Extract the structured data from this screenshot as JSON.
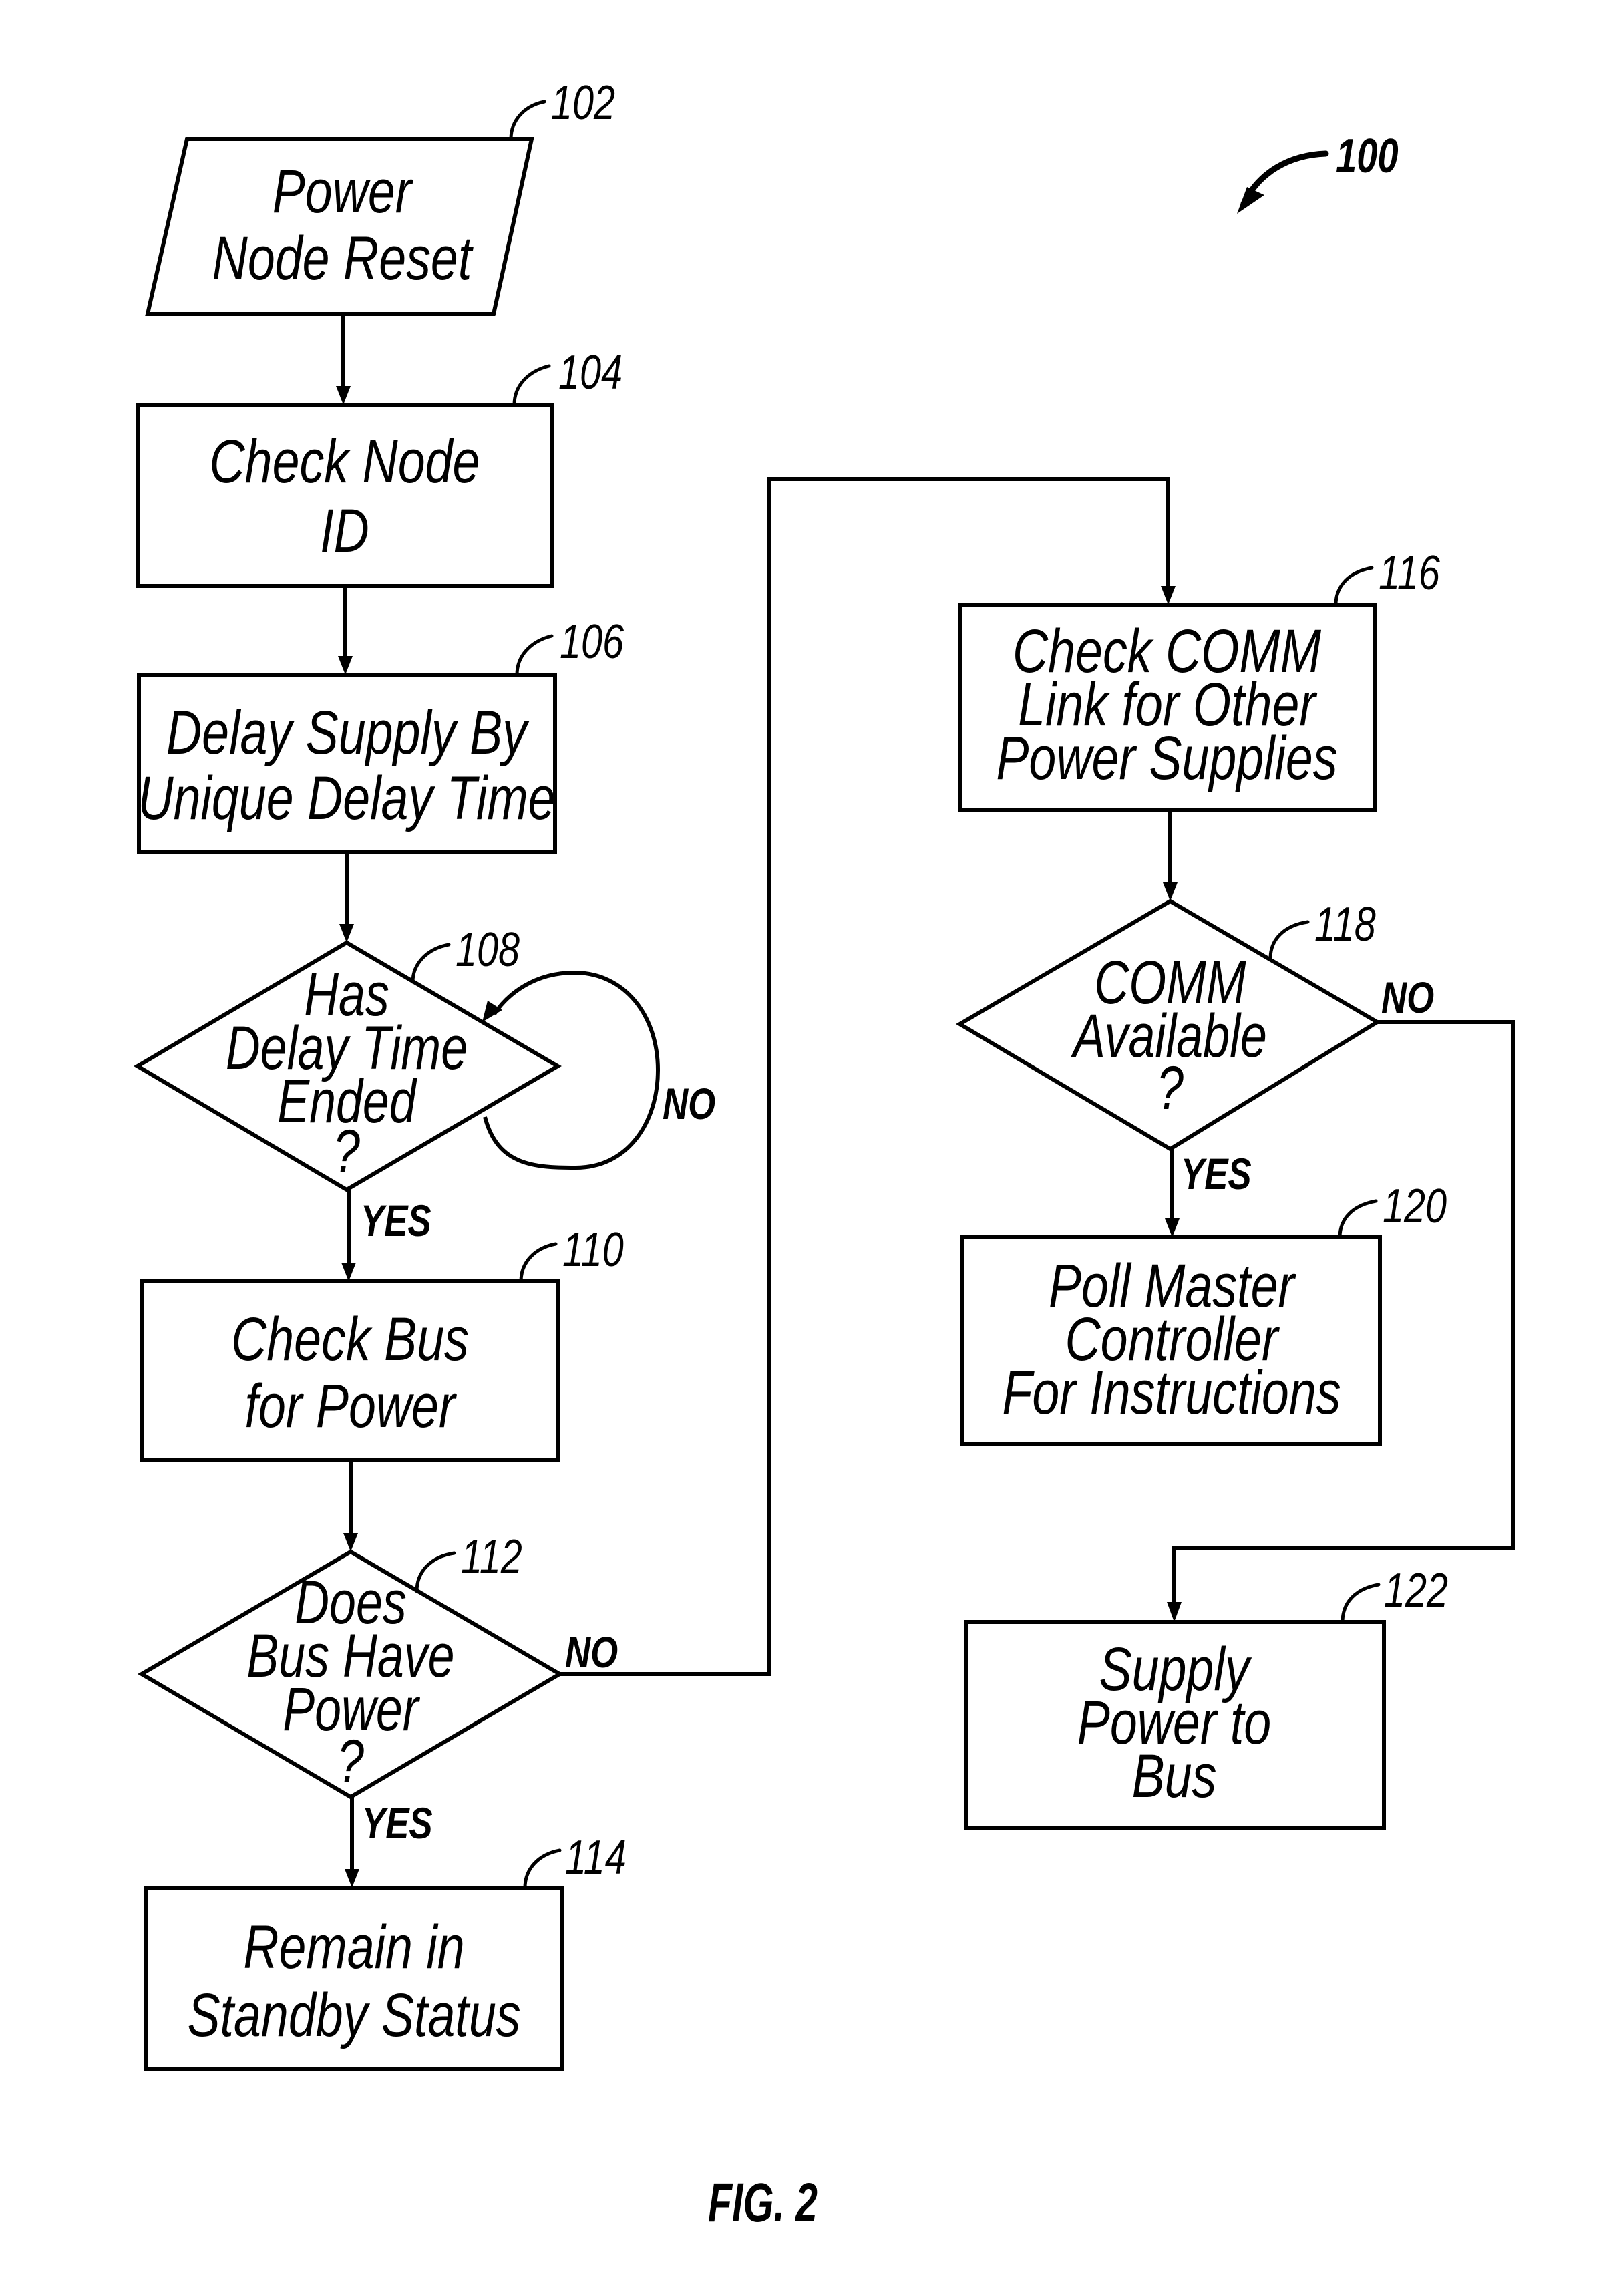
{
  "figure": {
    "title": "FIG. 2",
    "reference": "100"
  },
  "nodes": {
    "n102": {
      "ref": "102",
      "shape": "parallelogram",
      "lines": [
        "Power",
        "Node Reset"
      ]
    },
    "n104": {
      "ref": "104",
      "shape": "process",
      "lines": [
        "Check Node",
        "ID"
      ]
    },
    "n106": {
      "ref": "106",
      "shape": "process",
      "lines": [
        "Delay Supply By",
        "Unique Delay Time"
      ]
    },
    "n108": {
      "ref": "108",
      "shape": "decision",
      "lines": [
        "Has",
        "Delay Time",
        "Ended",
        "?"
      ]
    },
    "n110": {
      "ref": "110",
      "shape": "process",
      "lines": [
        "Check Bus",
        "for Power"
      ]
    },
    "n112": {
      "ref": "112",
      "shape": "decision",
      "lines": [
        "Does",
        "Bus Have",
        "Power",
        "?"
      ]
    },
    "n114": {
      "ref": "114",
      "shape": "process",
      "lines": [
        "Remain in",
        "Standby Status"
      ]
    },
    "n116": {
      "ref": "116",
      "shape": "process",
      "lines": [
        "Check COMM",
        "Link for Other",
        "Power Supplies"
      ]
    },
    "n118": {
      "ref": "118",
      "shape": "decision",
      "lines": [
        "COMM",
        "Available",
        "?"
      ]
    },
    "n120": {
      "ref": "120",
      "shape": "process",
      "lines": [
        "Poll Master",
        "Controller",
        "For Instructions"
      ]
    },
    "n122": {
      "ref": "122",
      "shape": "process",
      "lines": [
        "Supply",
        "Power to",
        "Bus"
      ]
    }
  },
  "edges": [
    {
      "from": "102",
      "to": "104",
      "label": ""
    },
    {
      "from": "104",
      "to": "106",
      "label": ""
    },
    {
      "from": "106",
      "to": "108",
      "label": ""
    },
    {
      "from": "108",
      "to": "108",
      "label": "NO"
    },
    {
      "from": "108",
      "to": "110",
      "label": "YES"
    },
    {
      "from": "110",
      "to": "112",
      "label": ""
    },
    {
      "from": "112",
      "to": "114",
      "label": "YES"
    },
    {
      "from": "112",
      "to": "116",
      "label": "NO"
    },
    {
      "from": "116",
      "to": "118",
      "label": ""
    },
    {
      "from": "118",
      "to": "120",
      "label": "YES"
    },
    {
      "from": "118",
      "to": "122",
      "label": "NO"
    }
  ],
  "branch_labels": {
    "yes": "YES",
    "no": "NO"
  }
}
